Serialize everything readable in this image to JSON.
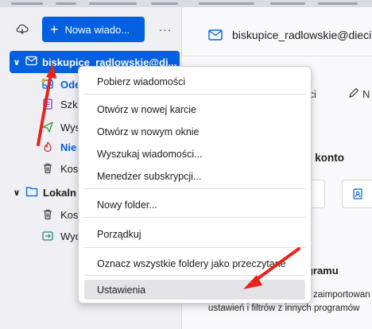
{
  "toolbar": {
    "new_message_label": "Nowa wiado...",
    "more_label": "···"
  },
  "account": {
    "name": "biskupice_radlowskie@di..."
  },
  "folders": [
    {
      "label": "Ode",
      "style": "bold-blue",
      "icon": "inbox-icon"
    },
    {
      "label": "Szki",
      "style": "normal",
      "icon": "drafts-icon"
    },
    {
      "label": "Wys",
      "style": "normal",
      "icon": "sent-icon"
    },
    {
      "label": "Nie",
      "style": "bold-blue",
      "icon": "spam-icon"
    },
    {
      "label": "Kosz",
      "style": "normal",
      "icon": "trash-icon"
    }
  ],
  "local": {
    "name": "Lokaln",
    "folders": [
      {
        "label": "Kosz",
        "icon": "trash-icon"
      },
      {
        "label": "Wyc",
        "icon": "outbox-icon"
      }
    ]
  },
  "header": {
    "email": "biskupice_radlowskie@dieci",
    "frag_news": "ści",
    "frag_n": "N",
    "frag_account": "e konto",
    "program_title": "ogramu",
    "program_line1": "zaimportowan",
    "program_line2": "ustawień i filtrów z innych programów"
  },
  "context_menu": {
    "items": [
      {
        "label": "Pobierz wiadomości",
        "key": "get-messages"
      },
      {
        "label": "Otwórz w nowej karcie",
        "key": "open-new-tab"
      },
      {
        "label": "Otwórz w nowym oknie",
        "key": "open-new-window"
      },
      {
        "label": "Wyszukaj wiadomości...",
        "key": "search-messages"
      },
      {
        "label": "Menedżer subskrypcji...",
        "key": "subscription-manager"
      },
      {
        "label": "Nowy folder...",
        "key": "new-folder"
      },
      {
        "label": "Porządkuj",
        "key": "compact"
      },
      {
        "label": "Oznacz wszystkie foldery jako przeczytane",
        "key": "mark-all-read"
      },
      {
        "label": "Ustawienia",
        "key": "settings",
        "highlighted": true
      }
    ]
  },
  "colors": {
    "accent": "#0060df",
    "annotation_arrow": "#e8231a",
    "menu_highlight": "#e4e4e8"
  }
}
